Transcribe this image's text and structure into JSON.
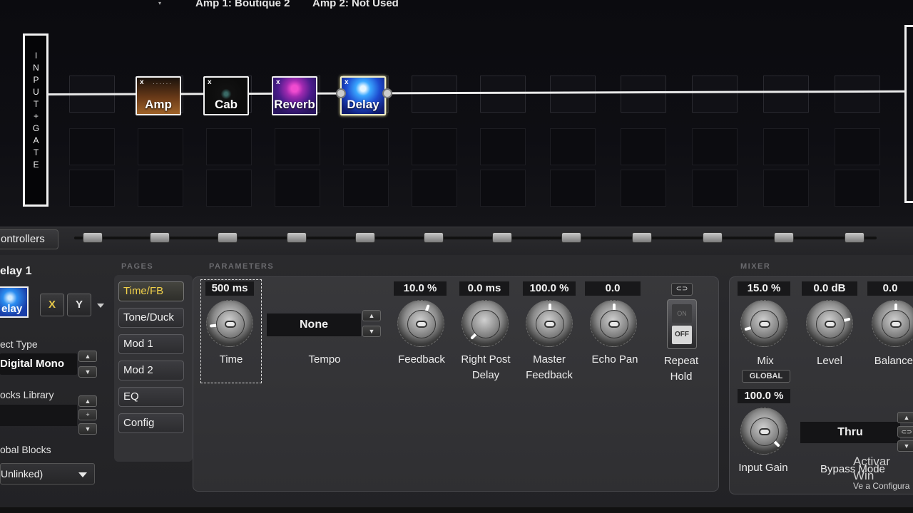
{
  "header": {
    "amp1": "Amp 1: Boutique 2",
    "amp2": "Amp 2: Not Used"
  },
  "input": {
    "label": "I\nN\nP\nU\nT\n+\nG\nA\nT\nE"
  },
  "chain": {
    "blocks": [
      {
        "x": "x",
        "label": "Amp"
      },
      {
        "x": "x",
        "label": "Cab"
      },
      {
        "x": "x",
        "label": "Reverb"
      },
      {
        "x": "x",
        "label": "Delay"
      }
    ]
  },
  "controllers": {
    "label": "ontrollers"
  },
  "block_info": {
    "title": "elay 1",
    "thumb_label": "elay",
    "x_label": "X",
    "y_label": "Y",
    "effect_type_label": "ect Type",
    "effect_type_value": "Digital Mono",
    "blocks_library_label": "ocks Library",
    "global_blocks_label": "obal Blocks",
    "global_blocks_value": "Unlinked)"
  },
  "pages": {
    "title": "PAGES",
    "items": [
      "Time/FB",
      "Tone/Duck",
      "Mod 1",
      "Mod 2",
      "EQ",
      "Config"
    ],
    "active": "Time/FB"
  },
  "parameters": {
    "title": "PARAMETERS",
    "time": {
      "value": "500 ms",
      "label": "Time"
    },
    "tempo": {
      "value": "None",
      "label": "Tempo"
    },
    "feedback": {
      "value": "10.0 %",
      "label": "Feedback"
    },
    "right_post_delay": {
      "value": "0.0 ms",
      "label1": "Right Post",
      "label2": "Delay"
    },
    "master_feedback": {
      "value": "100.0 %",
      "label1": "Master",
      "label2": "Feedback"
    },
    "echo_pan": {
      "value": "0.0",
      "label": "Echo Pan"
    },
    "repeat_hold": {
      "label1": "Repeat",
      "label2": "Hold",
      "on": "ON",
      "off": "OFF"
    }
  },
  "mixer": {
    "title": "MIXER",
    "mix": {
      "value": "15.0 %",
      "label": "Mix",
      "global": "GLOBAL"
    },
    "level": {
      "value": "0.0 dB",
      "label": "Level"
    },
    "balance": {
      "value": "0.0",
      "label": "Balance"
    },
    "input_gain": {
      "value": "100.0 %",
      "label": "Input Gain"
    },
    "bypass_mode": {
      "value": "Thru",
      "label": "Bypass Mode"
    }
  },
  "watermark": {
    "line1": "Activar Win",
    "line2": "Ve a Configura"
  },
  "colors": {
    "accent": "#f2d24a",
    "signal": "#eaeaea",
    "panel": "#333336"
  }
}
